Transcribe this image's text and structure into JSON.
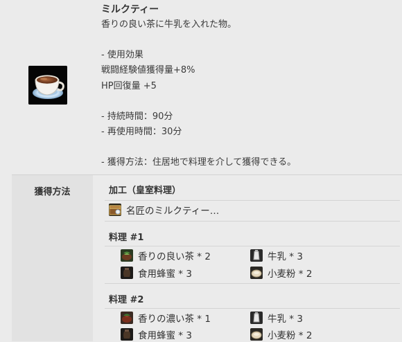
{
  "item": {
    "name": "ミルクティー",
    "icon": "milk-tea-cup-icon",
    "description_lines": [
      "香りの良い茶に牛乳を入れた物。",
      "",
      "- 使用効果",
      "戦闘経験値獲得量+8%",
      "HP回復量 +5",
      "",
      "- 持続時間：90分",
      "- 再使用時間：30分",
      "",
      "- 獲得方法：住居地で料理を介して獲得できる。"
    ]
  },
  "acquisition": {
    "label": "獲得方法",
    "processing": {
      "title": "加工（皇室料理）",
      "item": {
        "label": "名匠のミルクティー…",
        "icon": "royal-crate-icon"
      }
    },
    "recipe1": {
      "title": "料理 #1",
      "ingredients": [
        {
          "label": "香りの良い茶 * 2",
          "icon": "tea-icon"
        },
        {
          "label": "牛乳 * 3",
          "icon": "milk-icon"
        },
        {
          "label": "食用蜂蜜 * 3",
          "icon": "honey-icon"
        },
        {
          "label": "小麦粉 * 2",
          "icon": "flour-icon"
        }
      ]
    },
    "recipe2": {
      "title": "料理 #2",
      "ingredients": [
        {
          "label": "香りの濃い茶 * 1",
          "icon": "strong-tea-icon"
        },
        {
          "label": "牛乳 * 3",
          "icon": "milk-icon"
        },
        {
          "label": "食用蜂蜜 * 3",
          "icon": "honey-icon"
        },
        {
          "label": "小麦粉 * 2",
          "icon": "flour-icon"
        }
      ]
    }
  }
}
